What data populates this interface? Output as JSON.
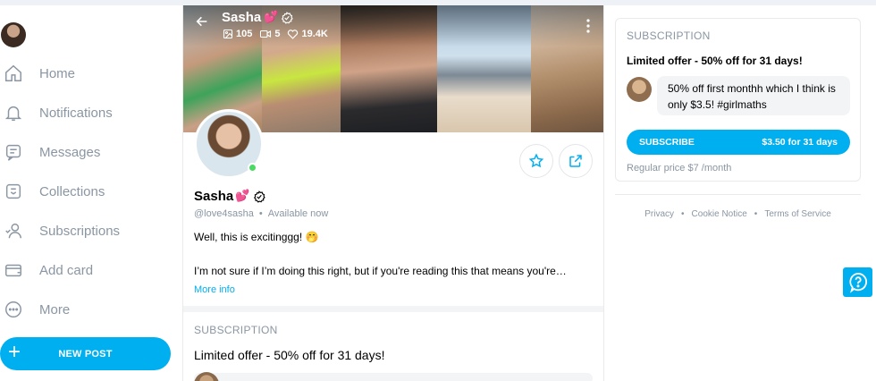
{
  "sidebar": {
    "items": [
      {
        "label": "Home",
        "icon": "home-icon"
      },
      {
        "label": "Notifications",
        "icon": "bell-icon"
      },
      {
        "label": "Messages",
        "icon": "message-icon"
      },
      {
        "label": "Collections",
        "icon": "bookmark-icon"
      },
      {
        "label": "Subscriptions",
        "icon": "subscriptions-icon"
      },
      {
        "label": "Add card",
        "icon": "card-icon"
      },
      {
        "label": "More",
        "icon": "more-icon"
      }
    ],
    "new_post": "NEW POST"
  },
  "banner": {
    "name": "Sasha",
    "heart": "💕",
    "stats": {
      "photos": "105",
      "videos": "5",
      "likes": "19.4K"
    }
  },
  "profile": {
    "name": "Sasha",
    "heart": "💕",
    "handle": "@love4sasha",
    "separator": "•",
    "status": "Available now",
    "bio_line1": "Well, this is excitinggg! 🤭",
    "bio_line2": "I’m not sure if I’m doing this right, but if you're reading this that means you're…",
    "more_info": "More info"
  },
  "center_subscription": {
    "title": "SUBSCRIPTION",
    "offer": "Limited offer - 50% off for 31 days!"
  },
  "right_subscription": {
    "title": "SUBSCRIPTION",
    "offer": "Limited offer - 50% off for 31 days!",
    "message": "50% off first monthh which I think is only $3.5! #girlmaths",
    "subscribe_label": "SUBSCRIBE",
    "subscribe_price": "$3.50 for 31 days",
    "regular_price": "Regular price $7 /month"
  },
  "footer": {
    "privacy": "Privacy",
    "cookie": "Cookie Notice",
    "terms": "Terms of Service",
    "dot": "•"
  },
  "colors": {
    "accent": "#00aff0",
    "muted": "#8a96a3",
    "online": "#4cd964"
  }
}
